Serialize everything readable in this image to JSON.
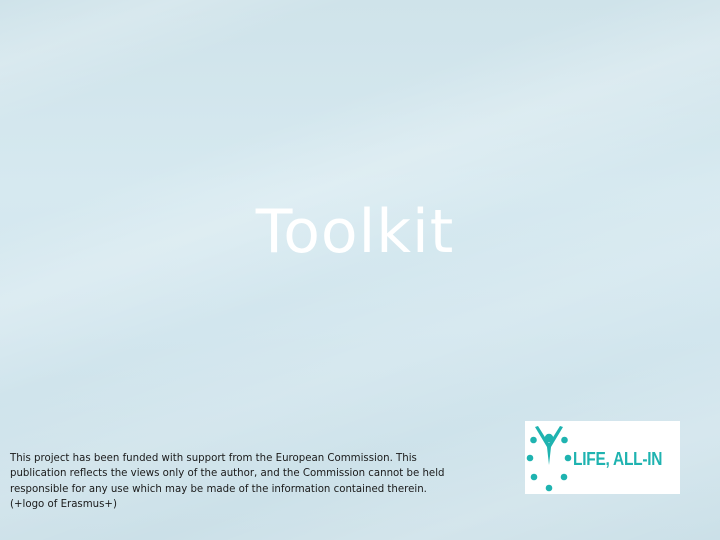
{
  "slide": {
    "title": "Toolkit",
    "disclaimer_lines": [
      "This project has been funded with support from the European Commission. This",
      "publication reflects the views only of the author, and the Commission cannot be held",
      "responsible for any use which may be made of the information contained therein.",
      "(+logo of Erasmus+)"
    ],
    "logo": {
      "text": "LIFE, ALL-IN",
      "icon": "figure-with-dots-icon",
      "color": "#1fb3b0"
    }
  },
  "colors": {
    "background": "#d3e7ee",
    "title": "#ffffff",
    "body_text": "#1a1a1a",
    "logo_accent": "#1fb3b0"
  }
}
